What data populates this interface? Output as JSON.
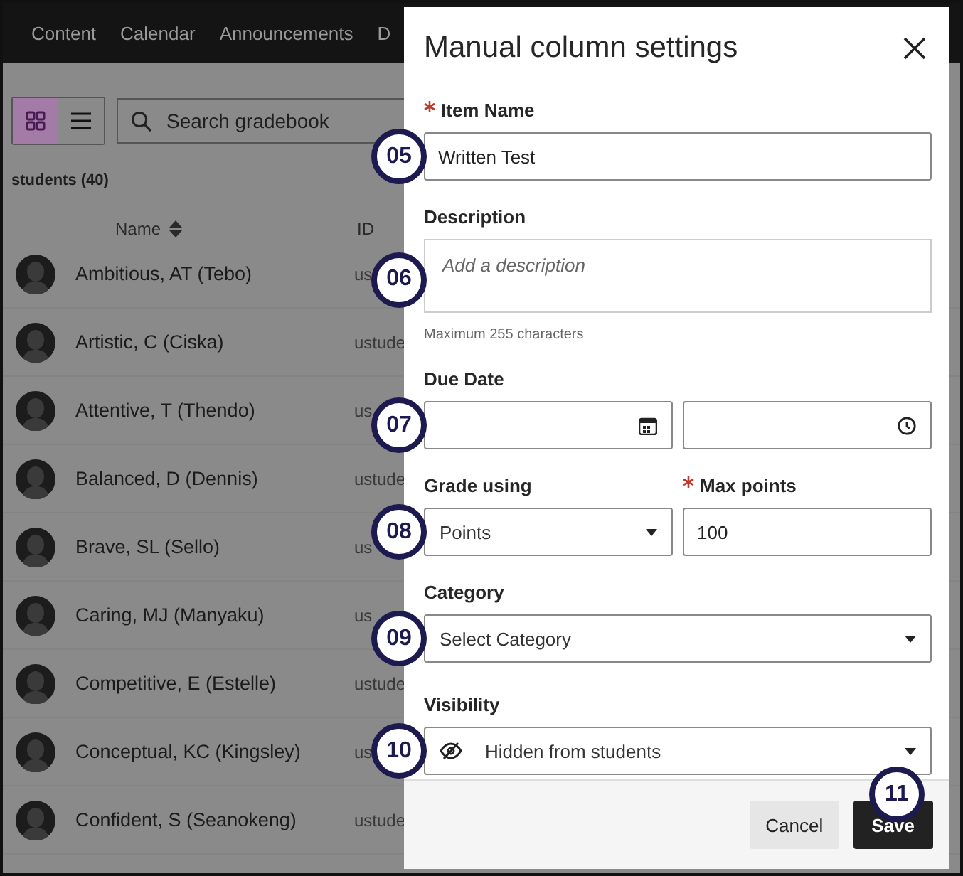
{
  "nav": {
    "items": [
      "Content",
      "Calendar",
      "Announcements",
      "D"
    ]
  },
  "toolbar": {
    "views": [
      {
        "kind": "grid",
        "selected": true
      },
      {
        "kind": "list",
        "selected": false
      }
    ],
    "search": {
      "placeholder": "Search gradebook"
    }
  },
  "student_count": "students (40)",
  "columns": [
    {
      "label": "Name",
      "sortable": true
    },
    {
      "label": "ID",
      "sortable": false
    }
  ],
  "students": [
    {
      "name": "Ambitious, AT (Tebo)",
      "id": "us"
    },
    {
      "name": "Artistic, C (Ciska)",
      "id": "ustude"
    },
    {
      "name": "Attentive, T (Thendo)",
      "id": "us"
    },
    {
      "name": "Balanced, D (Dennis)",
      "id": "ustude"
    },
    {
      "name": "Brave, SL (Sello)",
      "id": "us"
    },
    {
      "name": "Caring, MJ (Manyaku)",
      "id": "us"
    },
    {
      "name": "Competitive, E (Estelle)",
      "id": "ustude"
    },
    {
      "name": "Conceptual, KC (Kingsley)",
      "id": "us"
    },
    {
      "name": "Confident, S (Seanokeng)",
      "id": "ustude"
    }
  ],
  "dialog": {
    "title": "Manual column settings",
    "item_name": {
      "label": "Item Name",
      "required": true,
      "value": "Written Test",
      "callout": "05"
    },
    "description": {
      "label": "Description",
      "placeholder": "Add a description",
      "hint": "Maximum 255 characters",
      "callout": "06"
    },
    "due_date": {
      "label": "Due Date",
      "callout": "07"
    },
    "grade_using": {
      "label": "Grade using",
      "value": "Points",
      "callout": "08"
    },
    "max_points": {
      "label": "Max points",
      "required": true,
      "value": "100"
    },
    "category": {
      "label": "Category",
      "value": "Select Category",
      "callout": "09"
    },
    "visibility": {
      "label": "Visibility",
      "value": "Hidden from students",
      "callout": "10"
    },
    "cancel": "Cancel",
    "save": {
      "label": "Save",
      "callout": "11"
    }
  }
}
